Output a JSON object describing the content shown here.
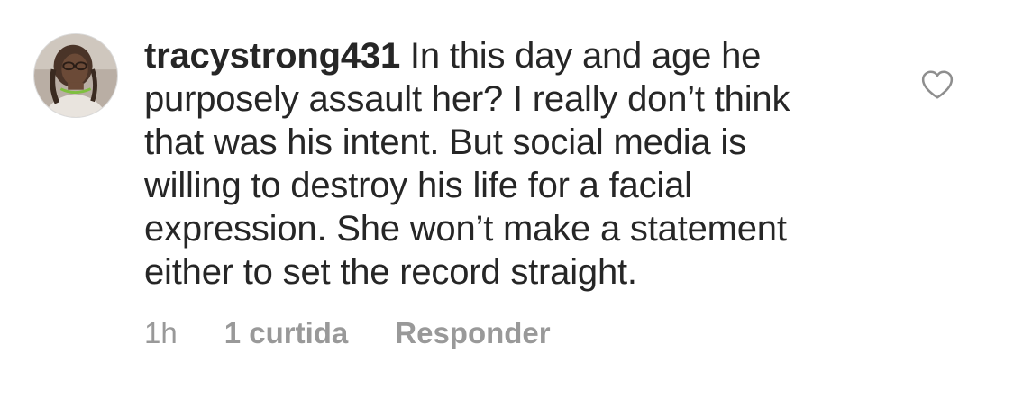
{
  "comment": {
    "username": "tracystrong431",
    "text": "In this day and age he\npurposely assault her? I really don’t think\nthat was his intent. But social media is\nwilling to destroy his life for a facial\nexpression. She won’t make a statement\neither to set the record straight.",
    "timestamp": "1h",
    "likes_label": "1 curtida",
    "reply_label": "Responder"
  },
  "icons": {
    "like": "heart-outline-icon",
    "avatar": "profile-photo"
  },
  "colors": {
    "text": "#262626",
    "meta": "#999999",
    "icon": "#8e8e8e"
  }
}
